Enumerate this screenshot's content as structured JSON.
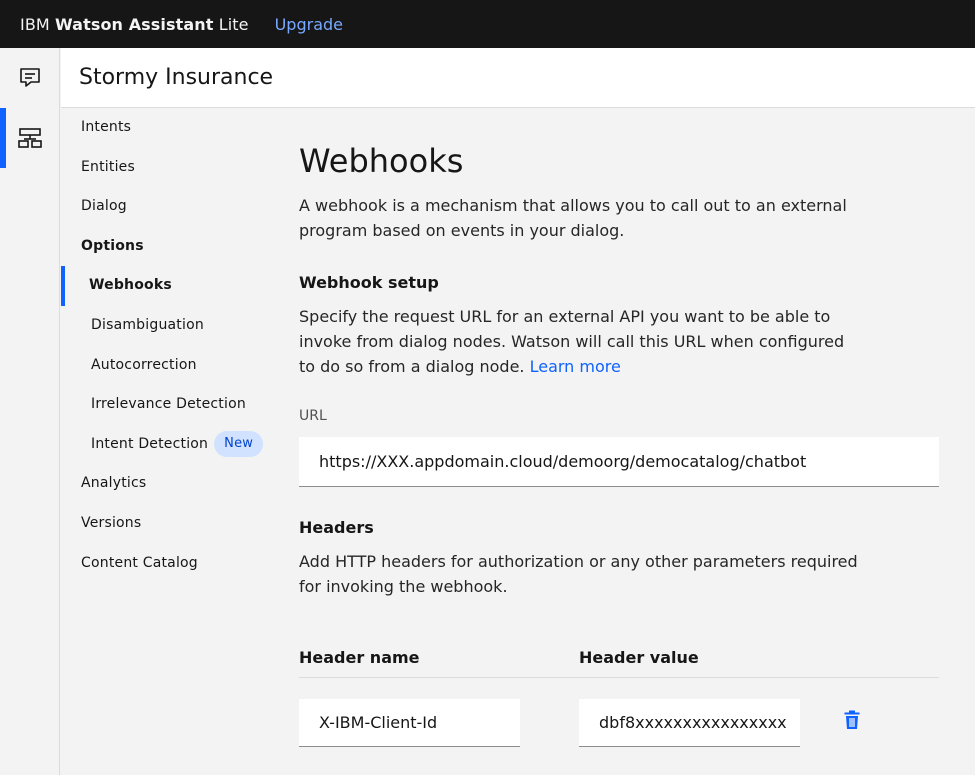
{
  "topbar": {
    "brand_prefix": "IBM ",
    "brand_name": "Watson Assistant",
    "brand_suffix": " Lite",
    "upgrade_label": "Upgrade"
  },
  "rail": {
    "items": [
      {
        "icon": "chat-icon"
      },
      {
        "icon": "skills-icon",
        "active": true
      }
    ]
  },
  "header": {
    "title": "Stormy Insurance"
  },
  "sidebar": {
    "items": [
      {
        "label": "Intents"
      },
      {
        "label": "Entities"
      },
      {
        "label": "Dialog"
      },
      {
        "label": "Options"
      },
      {
        "label": "Webhooks"
      },
      {
        "label": "Disambiguation"
      },
      {
        "label": "Autocorrection"
      },
      {
        "label": "Irrelevance Detection"
      },
      {
        "label": "Intent Detection",
        "badge": "New"
      },
      {
        "label": "Analytics"
      },
      {
        "label": "Versions"
      },
      {
        "label": "Content Catalog"
      }
    ]
  },
  "main": {
    "title": "Webhooks",
    "intro": "A webhook is a mechanism that allows you to call out to an external program based on events in your dialog.",
    "setup_title": "Webhook setup",
    "setup_desc": "Specify the request URL for an external API you want to be able to invoke from dialog nodes. Watson will call this URL when configured to do so from a dialog node. ",
    "learn_more": "Learn more",
    "url_label": "URL",
    "url_value": "https://XXX.appdomain.cloud/demoorg/democatalog/chatbot",
    "headers_title": "Headers",
    "headers_desc": "Add HTTP headers for authorization or any other parameters required for invoking the webhook.",
    "col_name": "Header name",
    "col_value": "Header value",
    "header_rows": [
      {
        "name": "X-IBM-Client-Id",
        "value": "dbf8xxxxxxxxxxxxxxxx"
      }
    ]
  },
  "colors": {
    "accent": "#0f62fe",
    "topbar": "#161616",
    "badge_bg": "#d0e2ff"
  }
}
